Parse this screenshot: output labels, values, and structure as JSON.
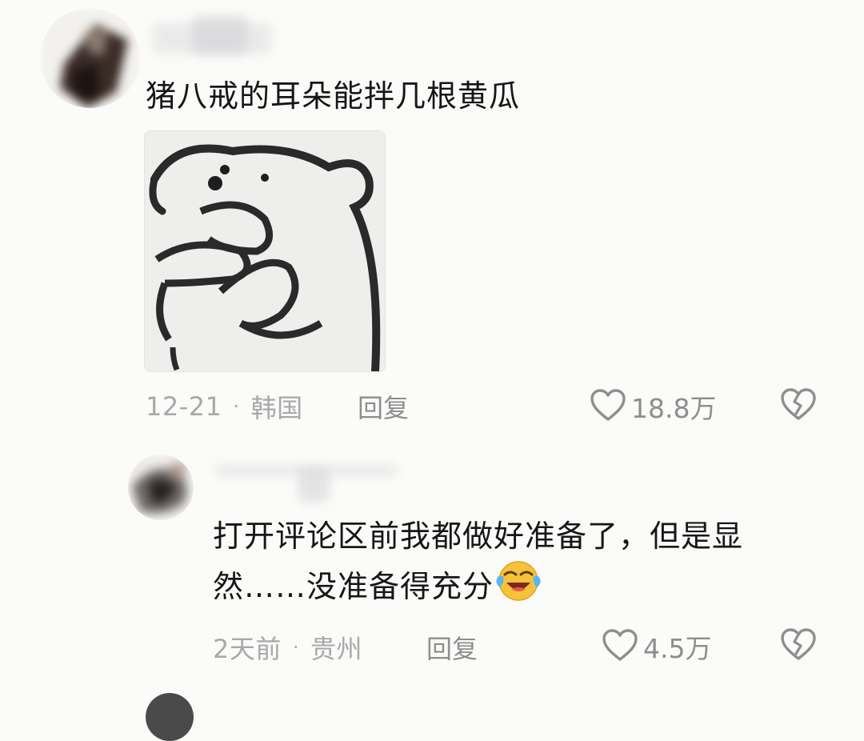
{
  "comments": [
    {
      "text": "猪八戒的耳朵能拌几根黄瓜",
      "date": "12-21",
      "location": "韩国",
      "reply_label": "回复",
      "likes": "18.8万",
      "has_sticker": true
    },
    {
      "text_line1": "打开评论区前我都做好准备了，但是显",
      "text_line2": "然……没准备得充分",
      "date": "2天前",
      "location": "贵州",
      "reply_label": "回复",
      "likes": "4.5万"
    }
  ],
  "separator": "·",
  "icons": {
    "like": "heart-outline-icon",
    "dislike": "broken-heart-icon",
    "emoji": "laughing-crying-emoji-icon"
  }
}
